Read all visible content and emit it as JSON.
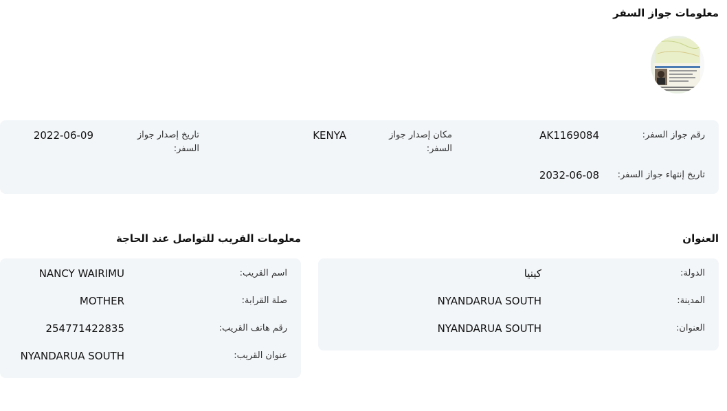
{
  "passport": {
    "title": "معلومات جواز السفر",
    "image_alt": "صورة جواز السفر",
    "number_label": "رقم جواز السفر:",
    "number_value": "AK1169084",
    "place_label": "مكان إصدار جواز السفر:",
    "place_value": "KENYA",
    "issue_label": "تاريخ إصدار جواز السفر:",
    "issue_value": "2022-06-09",
    "expiry_label": "تاريخ إنتهاء جواز السفر:",
    "expiry_value": "2032-06-08"
  },
  "address": {
    "title": "العنوان",
    "country_label": "الدولة:",
    "country_value": "كينيا",
    "city_label": "المدينة:",
    "city_value": "NYANDARUA SOUTH",
    "address_label": "العنوان:",
    "address_value": "NYANDARUA SOUTH"
  },
  "relative": {
    "title": "معلومات القريب للتواصل عند الحاجة",
    "name_label": "اسم القريب:",
    "name_value": "NANCY WAIRIMU",
    "relation_label": "صلة القرابة:",
    "relation_value": "MOTHER",
    "phone_label": "رقم هاتف القريب:",
    "phone_value": "254771422835",
    "address_label": "عنوان القريب:",
    "address_value": "NYANDARUA SOUTH"
  },
  "colors": {
    "panel_bg": "#f3f6f9",
    "text": "#111111",
    "label": "#333333"
  }
}
